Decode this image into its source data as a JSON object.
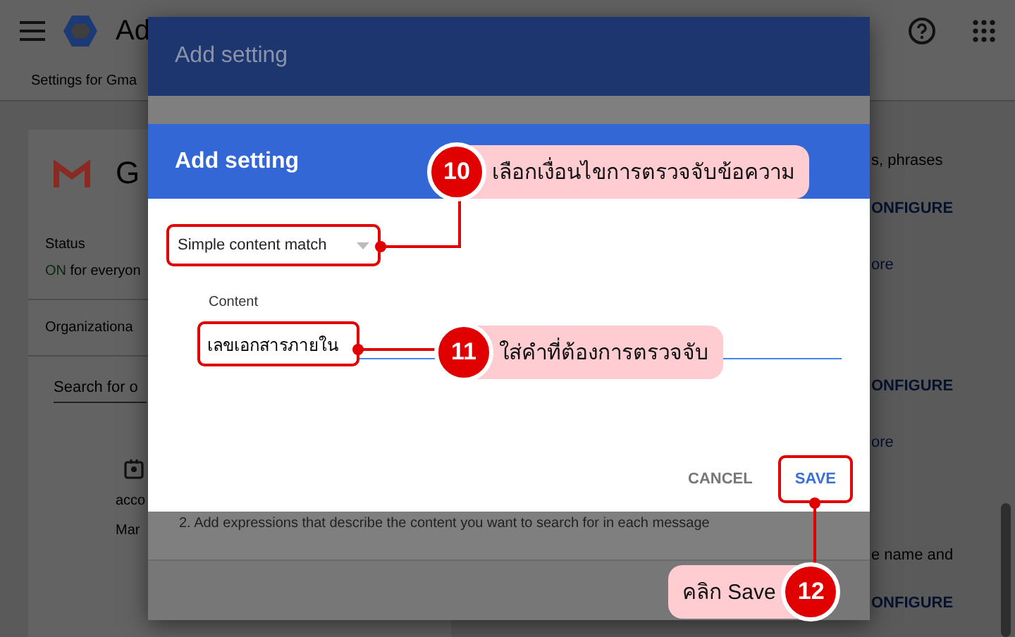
{
  "topbar": {
    "product": "Ad"
  },
  "breadcrumb": "Settings for Gma",
  "app_card": {
    "name": "G",
    "status_label": "Status",
    "status_value": "ON",
    "status_rest": " for everyon",
    "org_label": "Organizationa",
    "search_placeholder": "Search for o",
    "list_items": [
      "acco",
      "Mar"
    ]
  },
  "right_column": [
    {
      "kind": "text",
      "text": "s, phrases"
    },
    {
      "kind": "action",
      "text": "ONFIGURE"
    },
    {
      "kind": "link",
      "text": "ore"
    },
    {
      "kind": "action",
      "text": "ONFIGURE"
    },
    {
      "kind": "link",
      "text": "ore"
    },
    {
      "kind": "text",
      "text": "e name and"
    },
    {
      "kind": "action",
      "text": "ONFIGURE"
    }
  ],
  "outer_dialog": {
    "title": "Add setting",
    "instruction": "2. Add expressions that describe the content you want to search for in each message"
  },
  "dialog": {
    "title": "Add setting",
    "condition": {
      "value": "Simple content match",
      "highlighted": true
    },
    "content_label": "Content",
    "content": {
      "value": "เลขเอกสารภายใน",
      "highlighted": true
    },
    "buttons": [
      {
        "label": "CANCEL",
        "primary": false,
        "highlighted": false
      },
      {
        "label": "SAVE",
        "primary": true,
        "highlighted": true
      }
    ]
  },
  "callouts": [
    {
      "number": "10",
      "text": "เลือกเงื่อนไขการตรวจจับข้อความ"
    },
    {
      "number": "11",
      "text": "ใส่คำที่ต้องการตรวจจับ"
    },
    {
      "number": "12",
      "text": "คลิก Save"
    }
  ]
}
